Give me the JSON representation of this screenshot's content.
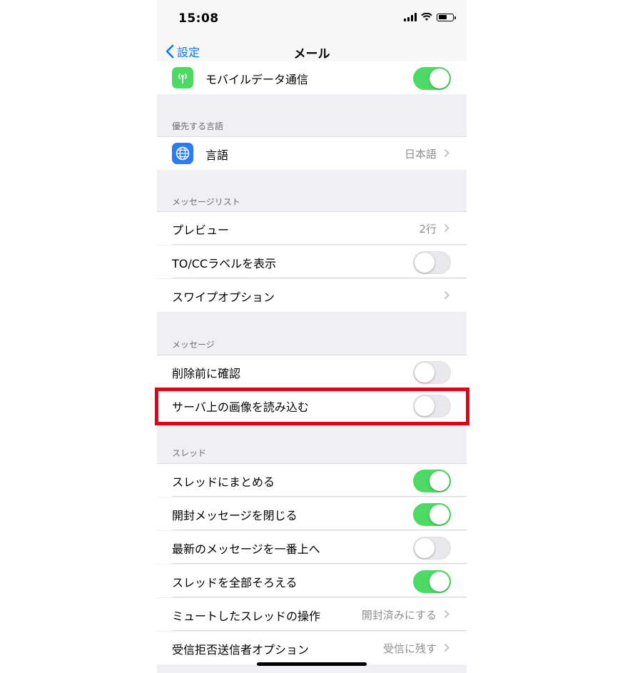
{
  "status": {
    "time": "15:08"
  },
  "nav": {
    "back_label": "設定",
    "title": "メール"
  },
  "sections": {
    "preferred_language": "優先する言語",
    "message_list": "メッセージリスト",
    "messages": "メッセージ",
    "threads": "スレッド"
  },
  "rows": {
    "mobile_data": {
      "label": "モバイルデータ通信",
      "toggle": "on"
    },
    "language": {
      "label": "言語",
      "value": "日本語"
    },
    "preview": {
      "label": "プレビュー",
      "value": "2行"
    },
    "to_cc": {
      "label": "TO/CCラベルを表示",
      "toggle": "off"
    },
    "swipe": {
      "label": "スワイプオプション"
    },
    "ask_delete": {
      "label": "削除前に確認",
      "toggle": "off"
    },
    "load_remote": {
      "label": "サーバ上の画像を読み込む",
      "toggle": "off"
    },
    "organize_thread": {
      "label": "スレッドにまとめる",
      "toggle": "on"
    },
    "collapse_read": {
      "label": "開封メッセージを閉じる",
      "toggle": "on"
    },
    "recent_top": {
      "label": "最新のメッセージを一番上へ",
      "toggle": "off"
    },
    "complete_threads": {
      "label": "スレッドを全部そろえる",
      "toggle": "on"
    },
    "muted_action": {
      "label": "ミュートしたスレッドの操作",
      "value": "開封済みにする"
    },
    "blocked_sender": {
      "label": "受信拒否送信者オプション",
      "value": "受信に残す"
    }
  },
  "colors": {
    "accent": "#007aff",
    "toggle_on": "#4cd964",
    "highlight": "#e60012"
  }
}
